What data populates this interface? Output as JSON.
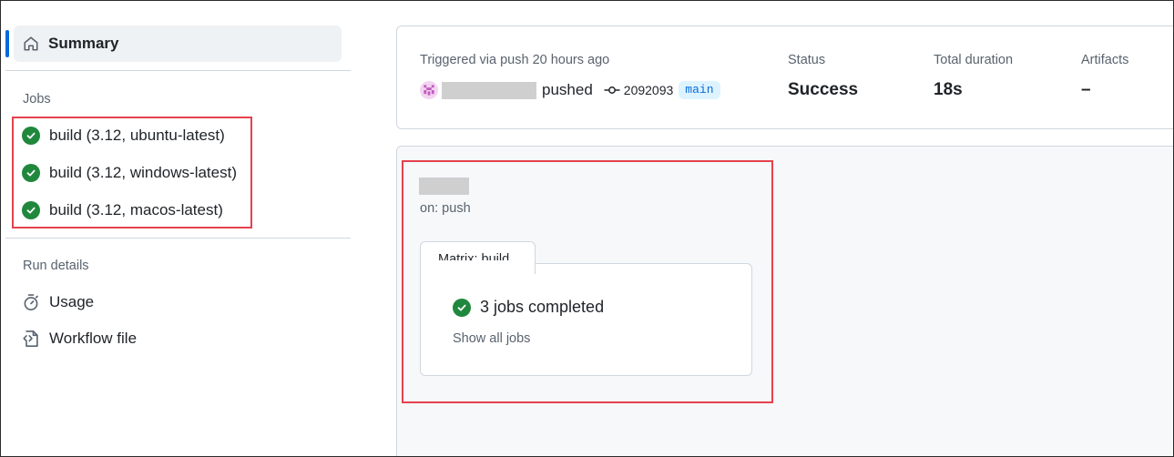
{
  "sidebar": {
    "summary_label": "Summary",
    "jobs_title": "Jobs",
    "jobs": [
      {
        "label": "build (3.12, ubuntu-latest)",
        "status": "success"
      },
      {
        "label": "build (3.12, windows-latest)",
        "status": "success"
      },
      {
        "label": "build (3.12, macos-latest)",
        "status": "success"
      }
    ],
    "run_details_title": "Run details",
    "details": [
      {
        "label": "Usage",
        "icon": "stopwatch-icon"
      },
      {
        "label": "Workflow file",
        "icon": "file-code-icon"
      }
    ]
  },
  "run": {
    "trigger_text": "Triggered via push 20 hours ago",
    "action_text": "pushed",
    "commit_sha": "2092093",
    "branch": "main",
    "status_label": "Status",
    "status_value": "Success",
    "duration_label": "Total duration",
    "duration_value": "18s",
    "artifacts_label": "Artifacts",
    "artifacts_value": "–"
  },
  "workflow": {
    "trigger": "on: push",
    "matrix_label": "Matrix: build",
    "completed_text": "3 jobs completed",
    "show_all_label": "Show all jobs"
  },
  "colors": {
    "success": "#1f883d",
    "accent": "#0969da",
    "highlight": "#e5424d"
  }
}
